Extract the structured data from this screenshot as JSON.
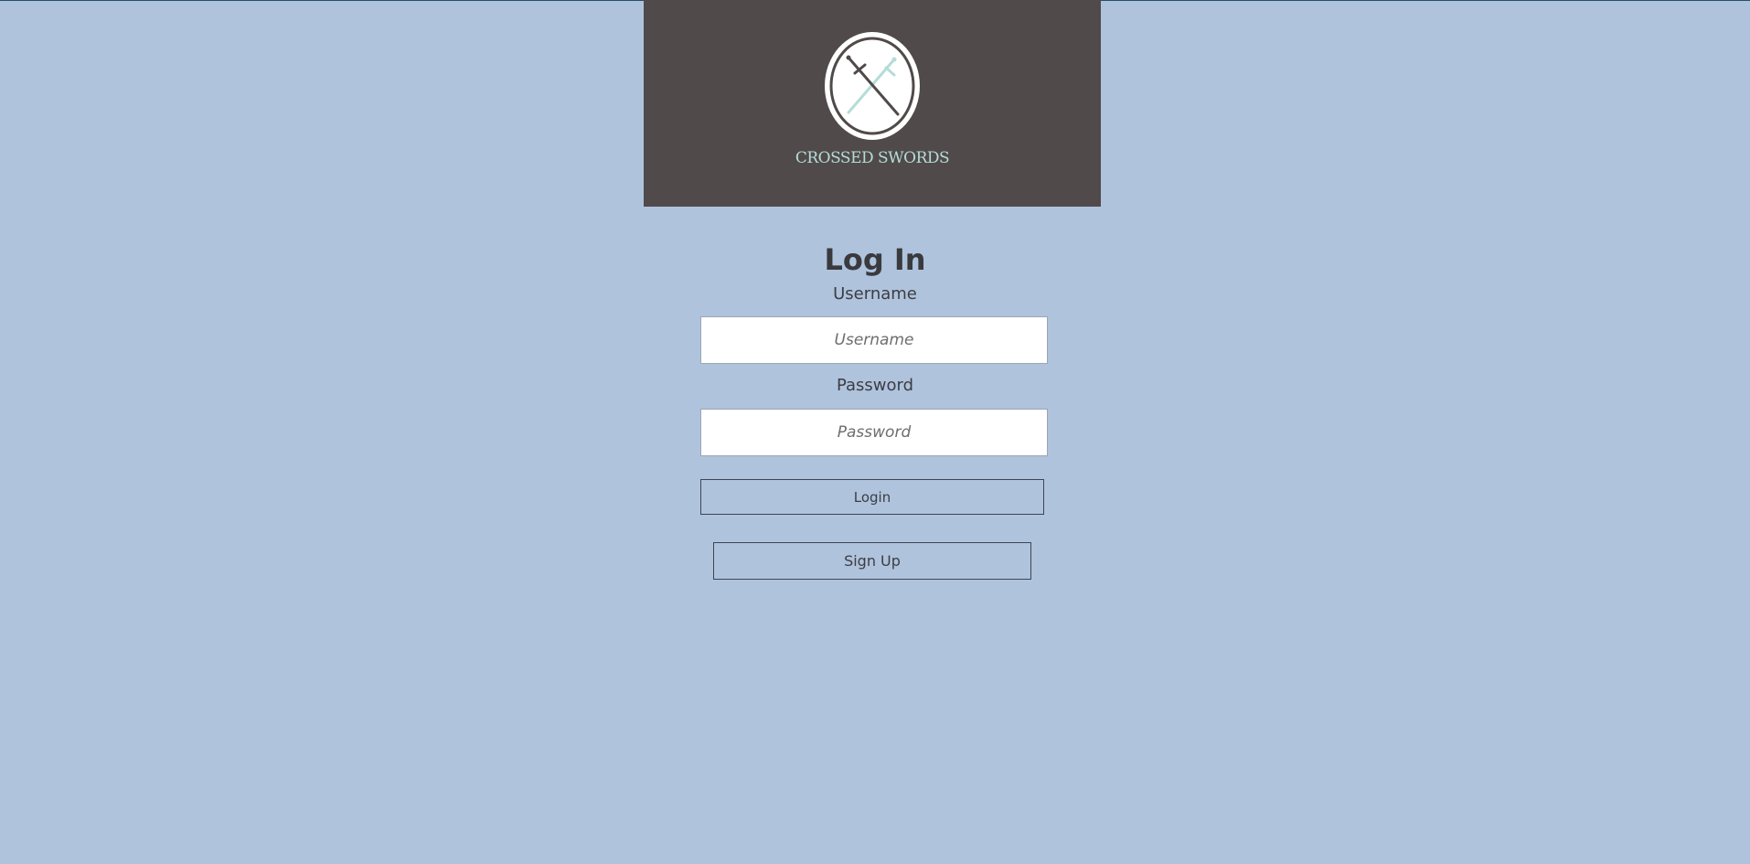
{
  "brand": {
    "name": "CROSSED SWORDS",
    "logo_icon": "crossed-swords-icon",
    "banner_color": "#514a4a",
    "accent_color": "#b4ddd7"
  },
  "page": {
    "background_color": "#afc3dd"
  },
  "login_form": {
    "title": "Log In",
    "username_label": "Username",
    "username_placeholder": "Username",
    "username_value": "",
    "password_label": "Password",
    "password_placeholder": "Password",
    "password_value": "",
    "login_button": "Login",
    "signup_button": "Sign Up"
  }
}
